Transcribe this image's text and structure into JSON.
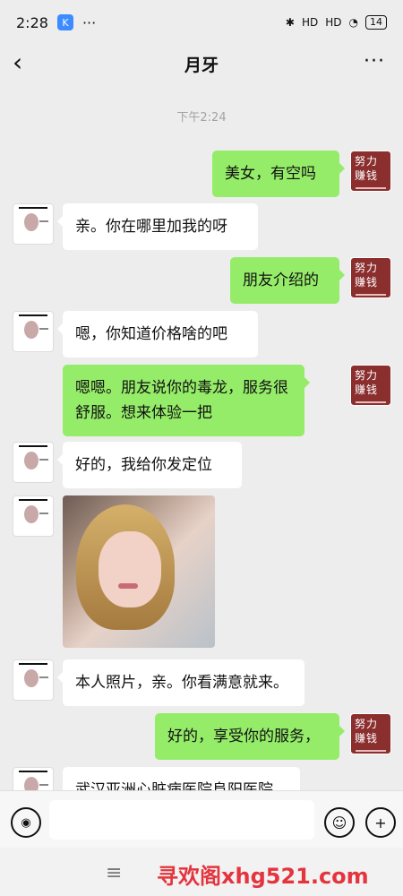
{
  "status": {
    "time": "2:28",
    "app_badge": "K",
    "more_dots": "···",
    "network_left": "HD",
    "network_right": "HD",
    "battery": "14"
  },
  "header": {
    "title": "月牙"
  },
  "timestamp": "下午2:24",
  "avatars": {
    "right_line1": "努力",
    "right_line2": "赚钱"
  },
  "messages": [
    {
      "side": "right",
      "text": "美女，有空吗"
    },
    {
      "side": "left",
      "text": "亲。你在哪里加我的呀"
    },
    {
      "side": "right",
      "text": "朋友介绍的"
    },
    {
      "side": "left",
      "text": "嗯，你知道价格啥的吧"
    },
    {
      "side": "right",
      "text": "嗯嗯。朋友说你的毒龙，服务很舒服。想来体验一把"
    },
    {
      "side": "left",
      "text": "好的，我给你发定位"
    },
    {
      "side": "left",
      "type": "image"
    },
    {
      "side": "left",
      "text": "本人照片，亲。你看满意就来。"
    },
    {
      "side": "right",
      "text": "好的，享受你的服务，"
    },
    {
      "side": "left",
      "text": "武汉亚洲心脏病医院阜阳医院"
    }
  ],
  "input": {
    "placeholder": ""
  },
  "watermark": "寻欢阁xhg521.com",
  "nav": {
    "menu_icon": "≡"
  }
}
